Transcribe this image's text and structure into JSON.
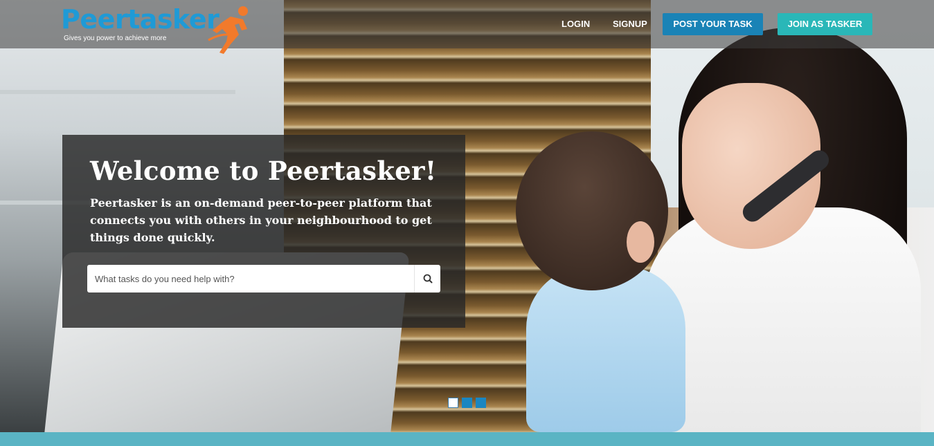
{
  "brand": {
    "name": "Peertasker",
    "tagline": "Gives you power to achieve more",
    "primary_color": "#1f9ad6",
    "runner_color": "#f27a2b"
  },
  "nav": {
    "login_label": "LOGIN",
    "signup_label": "SIGNUP",
    "post_task_label": "POST YOUR TASK",
    "join_tasker_label": "JOIN AS TASKER",
    "post_task_color": "#1a83b6",
    "join_tasker_color": "#2ab7b8"
  },
  "hero": {
    "title": "Welcome to Peertasker!",
    "description": "Peertasker is an on-demand peer-to-peer platform that connects you with others in your neighbourhood to get things done quickly.",
    "search": {
      "placeholder": "What tasks do you need help with?",
      "value": "",
      "icon": "search-icon"
    }
  },
  "carousel": {
    "slide_count": 3,
    "active_index": 0
  },
  "footer_strip_color": "#5ab4c4"
}
